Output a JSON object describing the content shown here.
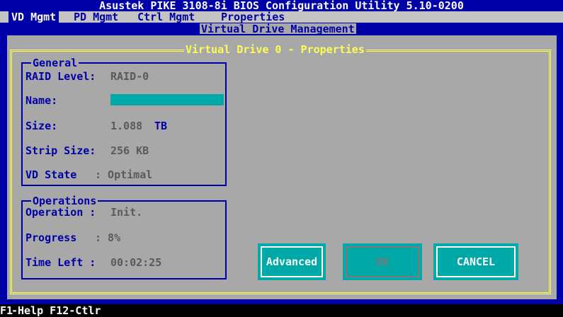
{
  "window": {
    "title": "Asustek PIKE 3108-8i BIOS Configuration Utility 5.10-0200"
  },
  "menu": [
    {
      "label": "VD Mgmt"
    },
    {
      "label": "PD Mgmt"
    },
    {
      "label": "Ctrl Mgmt"
    },
    {
      "label": "Properties"
    }
  ],
  "dialog": {
    "title": "Virtual Drive Management",
    "subtitle": "Virtual Drive 0 - Properties"
  },
  "general": {
    "title": "General",
    "raid_label": "RAID Level:",
    "raid_value": "RAID-0",
    "name_label": "Name:",
    "size_label": "Size:",
    "size_value": "1.088",
    "size_unit": "TB",
    "strip_label": "Strip Size:",
    "strip_value": "256 KB",
    "state_label": "VD State",
    "state_value": ": Optimal"
  },
  "operations": {
    "title": "Operations",
    "op_label": "Operation :",
    "op_value": "Init.",
    "progress_label": "Progress",
    "progress_value": ": 8%",
    "time_label": "Time Left :",
    "time_value": "00:02:25"
  },
  "buttons": {
    "advanced": "Advanced",
    "ok": "OK",
    "cancel": "CANCEL"
  },
  "statusbar": {
    "key": "F1",
    "text": "-Help F12-Ctlr"
  },
  "colors": {
    "background": "#0000a8",
    "dialog": "#a8a8a8",
    "accent": "#00a8a8",
    "highlight": "#fcfc54"
  }
}
